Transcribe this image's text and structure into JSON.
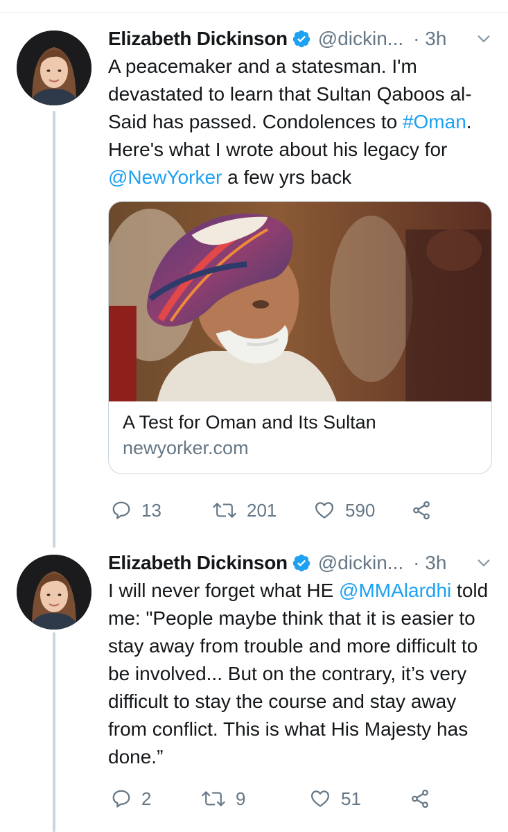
{
  "tweets": [
    {
      "author": "Elizabeth Dickinson",
      "handle": "@dickin...",
      "time": "· 3h",
      "text": {
        "p1": "A peacemaker and a statesman. I'm devastated to learn that Sultan Qaboos al-Said has passed. Condolences to ",
        "hashtag": "#Oman",
        "p2": ". Here's what I wrote about his legacy for ",
        "mention": "@NewYorker",
        "p3": " a few yrs back"
      },
      "card": {
        "title": "A Test for Oman and Its Sultan",
        "domain": "newyorker.com"
      },
      "actions": {
        "replies": "13",
        "retweets": "201",
        "likes": "590"
      }
    },
    {
      "author": "Elizabeth Dickinson",
      "handle": "@dickin...",
      "time": "· 3h",
      "text": {
        "p1": "I will never forget what HE ",
        "mention": "@MMAlardhi",
        "p2": " told me: \"People maybe think that it is easier to stay away from trouble and more difficult to be involved... But on the contrary, it’s very difficult to stay the course and stay away from conflict. This is what His Majesty has done.”"
      },
      "actions": {
        "replies": "2",
        "retweets": "9",
        "likes": "51"
      }
    }
  ],
  "colors": {
    "link": "#1da1f2",
    "secondary_text": "#657786",
    "thread_line": "#ccd6dd",
    "verified": "#1da1f2"
  },
  "icons": [
    "verified-badge-icon",
    "chevron-down-icon",
    "reply-icon",
    "retweet-icon",
    "like-icon",
    "share-icon"
  ]
}
